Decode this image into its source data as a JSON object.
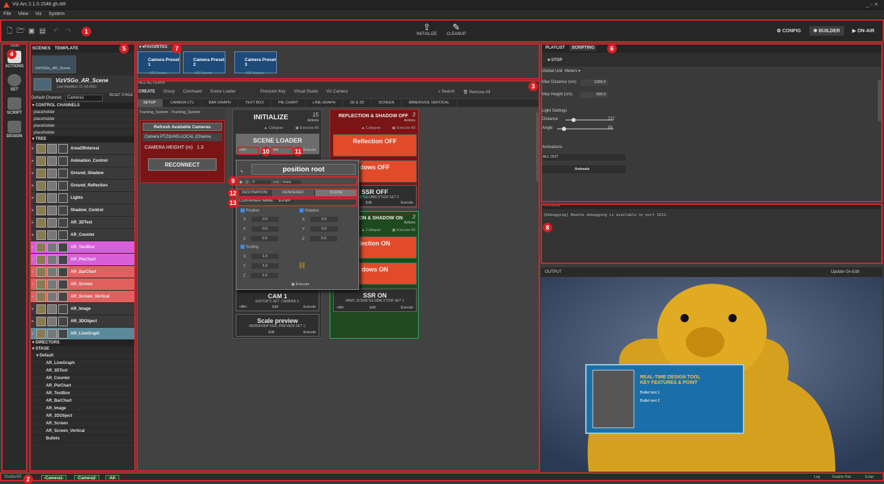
{
  "window": {
    "title": "Viz Arc 2.1.0.1548 gh:AR",
    "controls": "_ ▫ ✕"
  },
  "menu": [
    "File",
    "View",
    "Viz",
    "System"
  ],
  "toolbar": {
    "initialize": "INITIALIZE",
    "cleanup": "CLEANUP",
    "config": "CONFIG",
    "builder": "BUILDER",
    "on_air": "ON-AIR"
  },
  "badges": [
    "1",
    "2",
    "3",
    "4",
    "5",
    "6",
    "7",
    "8",
    "9",
    "10",
    "11",
    "12",
    "13"
  ],
  "tools": {
    "header": "Tools",
    "items": [
      {
        "label": "ACTIONS",
        "icon": "actions-icon"
      },
      {
        "label": "SET",
        "icon": "set-icon"
      },
      {
        "label": "SCRIPT",
        "icon": "script-icon"
      },
      {
        "label": "DESIGN",
        "icon": "design-icon"
      }
    ]
  },
  "scenes": {
    "tab_scenes": "SCENES",
    "tab_template": "TEMPLATE",
    "thumb_name": "VizVSGo_AR_Scene",
    "scene_name": "VizVSGo_AR_Scene",
    "last_modified": "Last Modified: 01-09-2021",
    "default_channel_label": "Default Channel:",
    "default_channel_value": "Camera1",
    "reset_stage": "RESET STAGE",
    "control_channels_header": "CONTROL CHANNELS",
    "placeholders": [
      "placeholder",
      "placeholder",
      "placeholder",
      "placeholder"
    ],
    "tree_header": "TREE",
    "tree": [
      {
        "name": "AreaOfInterest",
        "color": "plain"
      },
      {
        "name": "Animation_Control",
        "color": "plain"
      },
      {
        "name": "Ground_Shadow",
        "color": "plain"
      },
      {
        "name": "Ground_Reflection",
        "color": "plain"
      },
      {
        "name": "Lights",
        "color": "plain"
      },
      {
        "name": "Shadow_Control",
        "color": "plain"
      },
      {
        "name": "AR_3DText",
        "color": "plain"
      },
      {
        "name": "AR_Counter",
        "color": "plain"
      },
      {
        "name": "AR_TextBox",
        "color": "pink"
      },
      {
        "name": "AR_PieChart",
        "color": "pink"
      },
      {
        "name": "AR_BarChart",
        "color": "red"
      },
      {
        "name": "AR_Screen",
        "color": "red"
      },
      {
        "name": "AR_Screen_Vertical",
        "color": "red"
      },
      {
        "name": "AR_Image",
        "color": "plain"
      },
      {
        "name": "AR_3DObject",
        "color": "plain"
      },
      {
        "name": "AR_LineGraph",
        "color": "teal"
      }
    ],
    "directors_header": "DIRECTORS",
    "stage_header": "STAGE",
    "stage_default": "Default",
    "stage_items": [
      "AR_LineGraph",
      "AR_3DText",
      "AR_Counter",
      "AR_PieChart",
      "AR_TextBox",
      "AR_BarChart",
      "AR_Image",
      "AR_3DObject",
      "AR_Screen",
      "AR_Screen_Vertical",
      "Bullets"
    ]
  },
  "favorites": {
    "header": "FAVORITES",
    "items": [
      {
        "label": "Camera Preset 1",
        "sub": "NDI Source"
      },
      {
        "label": "Camera Preset 2",
        "sub": "NDI Source"
      },
      {
        "label": "Camera Preset 3",
        "sub": "NDI Source"
      }
    ]
  },
  "all_actions": {
    "header": "ALL ACTIONS",
    "create": "CREATE",
    "items": [
      "Group",
      "Command",
      "Scene Loader",
      "Precision Key",
      "Virtual Studio",
      "Viz Camera"
    ],
    "search": "Search",
    "remove_all": "Remove All"
  },
  "tabs": [
    "SETUP",
    "CAMERA CTL",
    "BAR GRAPH",
    "TEXT BOX",
    "PIE CHART",
    "LINE GRAPH",
    "3D & 2D",
    "SCREEN",
    "IMMERSIVE VERTICAL"
  ],
  "tracking": {
    "header": "Tracking_System - Tracking_System",
    "refresh": "Refresh Available Cameras",
    "camera": "Camera  PTZ3UHD-LOCAL (Channe",
    "height_label": "CAMERA HEIGHT (m)",
    "height_value": "1.3",
    "reconnect": "RECONNECT"
  },
  "init_group": {
    "title": "INITIALIZE",
    "count": "15",
    "count_label": "Actions",
    "collapse": "Collapse",
    "execute_all": "Execute All",
    "scene_loader": "SCENE LOADER",
    "all": "<All>",
    "edit": "Edit",
    "execute": "Execute",
    "cam1_title": "CAM 1",
    "cam1_sub": "EDITOR*1 SET_CAMERA 1;",
    "scale_title": "Scale preview",
    "scale_sub": "RENDERER*VGA_PREVIEW SET 1;"
  },
  "refl_off_group": {
    "title": "REFLECTION & SHADOW OFF",
    "count": "3",
    "count_label": "Actions",
    "collapse": "Collapse",
    "execute_all": "Execute All",
    "refl_off": "Reflection OFF",
    "shadows_off": "dows OFF",
    "ssr_off": "SSR OFF",
    "ssr_off_sub": "SCENE*GLOBALS*SSR SET 0",
    "edit": "Edit",
    "execute": "Execute"
  },
  "refl_on_group": {
    "title": "ION & SHADOW ON",
    "count": "3",
    "count_label": "Actions",
    "collapse": "Collapse",
    "execute_all": "Execute All",
    "refl_on": "lection ON",
    "shadows_on": "dows ON",
    "ssr_on": "SSR ON",
    "ssr_on_sub": "MAIN_SCENE*GLOBALS*SSR SET 1",
    "all": "<All>",
    "edit": "Edit",
    "execute": "Execute"
  },
  "popup": {
    "title": "position root",
    "time": "0",
    "ease": "none",
    "destination_label": "DESTINATION:",
    "dest_renderer": "RENDERER",
    "dest_scene": "SCENE",
    "container_label": "CONTAINER NAME",
    "container_value": "$Graph",
    "position": "Position",
    "rotation": "Rotation",
    "scaling": "Scaling",
    "pos": {
      "x": "0.0",
      "y": "0.0",
      "z": "0.0"
    },
    "rot": {
      "x": "0.0",
      "y": "0.0",
      "z": "0.0"
    },
    "scale": {
      "x": "1.0",
      "y": "1.0",
      "z": "1.0"
    },
    "execute": "Execute"
  },
  "right": {
    "tab_playlist": "PLAYLIST",
    "tab_scripting": "SCRIPTING",
    "stop": "STOP",
    "global_unit_label": "Global Unit",
    "global_unit_value": "Meters",
    "max_distance_label": "Max Distance (cm)",
    "max_distance_value": "1000.0",
    "max_height_label": "Max Height (cm)",
    "max_height_value": "500.0",
    "light_settings": "Light Settings",
    "distance_label": "Distance",
    "distance_value": "727",
    "angle_label": "Angle",
    "angle_value": "59",
    "animations_label": "Animations",
    "animations_value": "ALL OUT",
    "animate": "Animate"
  },
  "console": {
    "header": "CONSOLE",
    "text": "[Debugging] Remote debugging is available on port 9222."
  },
  "output": {
    "header": "OUTPUT",
    "update_on_edit": "Update On-Edit",
    "overlay_title1": "REAL-TIME DESIGN TOOL",
    "overlay_title2": "KEY FEATURES & POINT",
    "bullet1": "Bullet text 1",
    "bullet2": "Bullet text 2"
  },
  "status": {
    "left": "StudioAR",
    "cameras": [
      "-Camera1-",
      "-Camera2-",
      "-All-"
    ],
    "right": [
      "Log",
      "Graphic Hub",
      "Script"
    ]
  }
}
